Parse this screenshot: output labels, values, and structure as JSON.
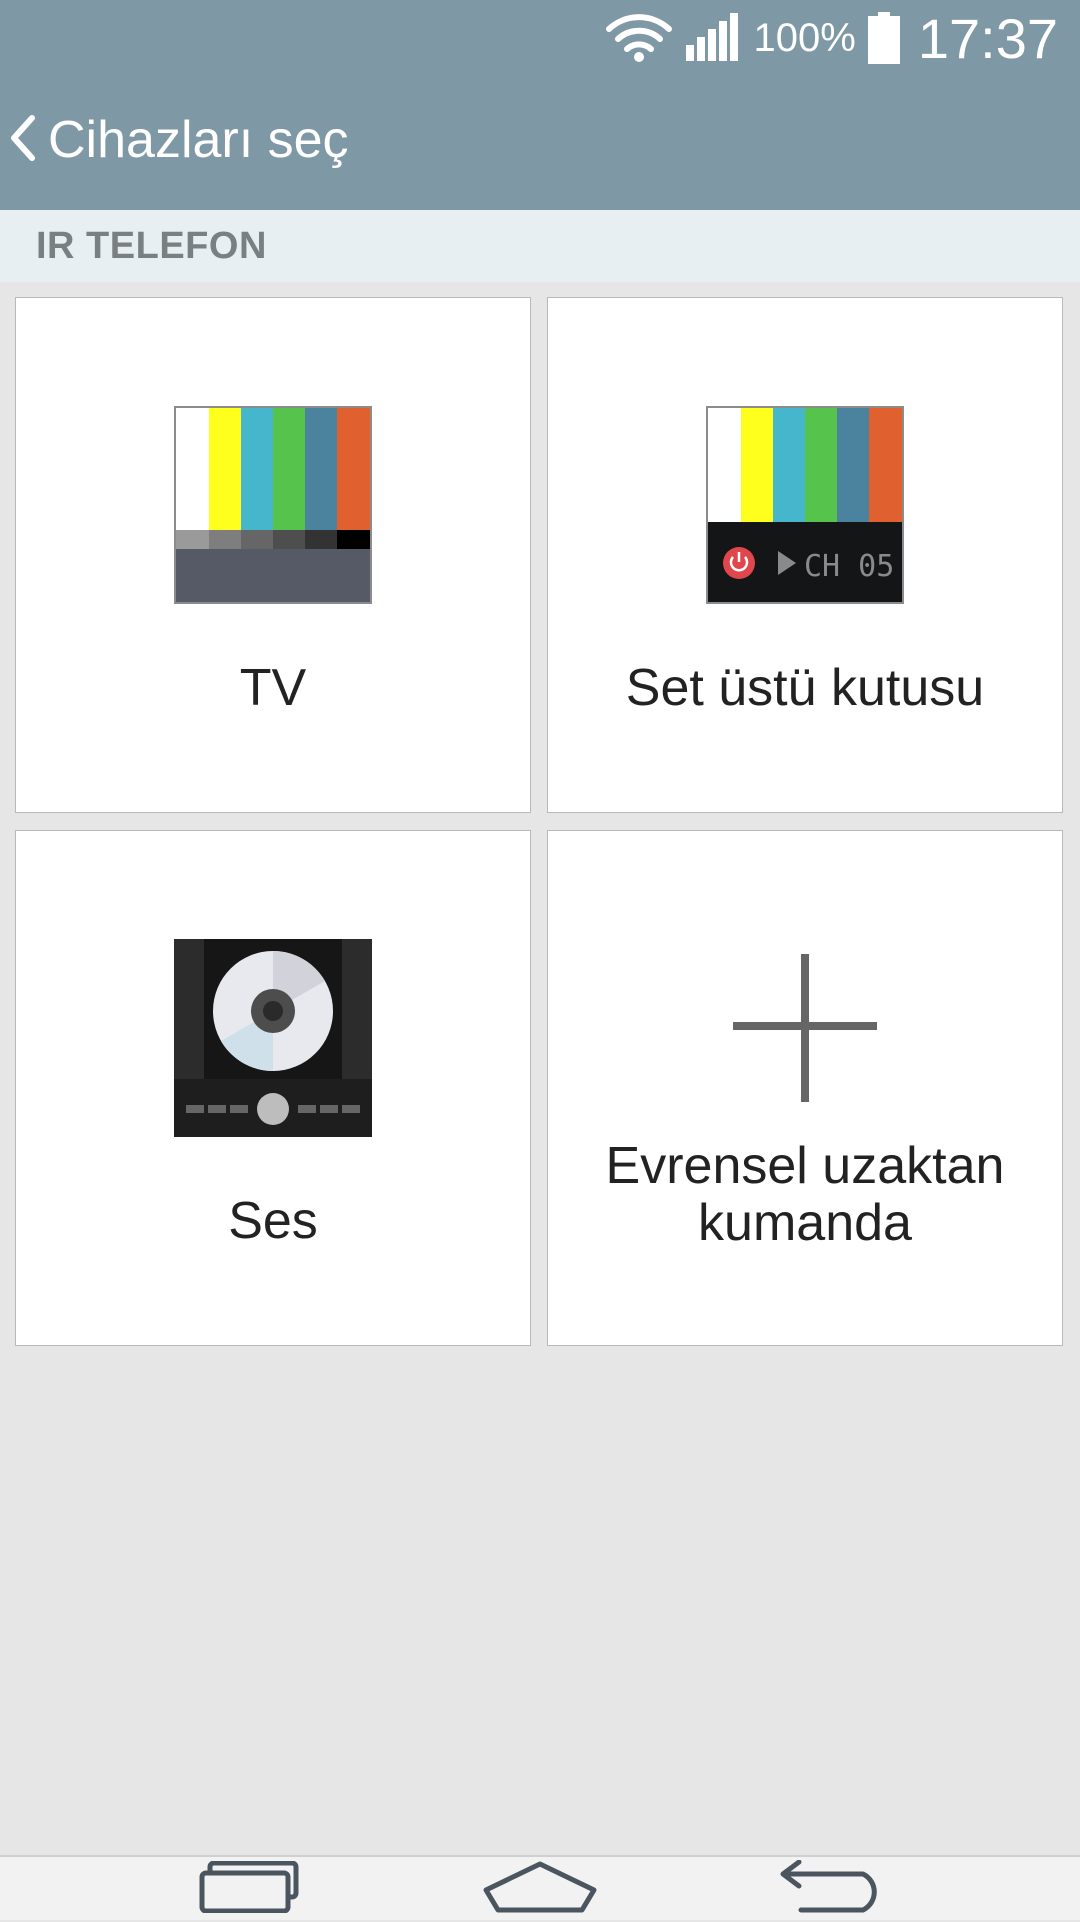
{
  "status_bar": {
    "battery_percent": "100%",
    "time": "17:37",
    "icons": [
      "wifi-icon",
      "signal-icon",
      "battery-icon"
    ]
  },
  "header": {
    "title": "Cihazları seç",
    "back_icon": "chevron-left-icon",
    "background_color": "#7f98a5"
  },
  "section": {
    "label": "IR TELEFON"
  },
  "devices": [
    {
      "label": "TV",
      "icon": "tv-test-pattern-icon"
    },
    {
      "label": "Set üstü kutusu",
      "icon": "set-top-box-icon",
      "display_text": "CH 05"
    },
    {
      "label": "Ses",
      "icon": "audio-cd-player-icon"
    },
    {
      "label_line1": "Evrensel uzaktan",
      "label_line2": "kumanda",
      "icon": "plus-icon"
    }
  ],
  "nav_bar": {
    "icons": [
      "recent-apps-icon",
      "home-icon",
      "back-icon"
    ]
  }
}
